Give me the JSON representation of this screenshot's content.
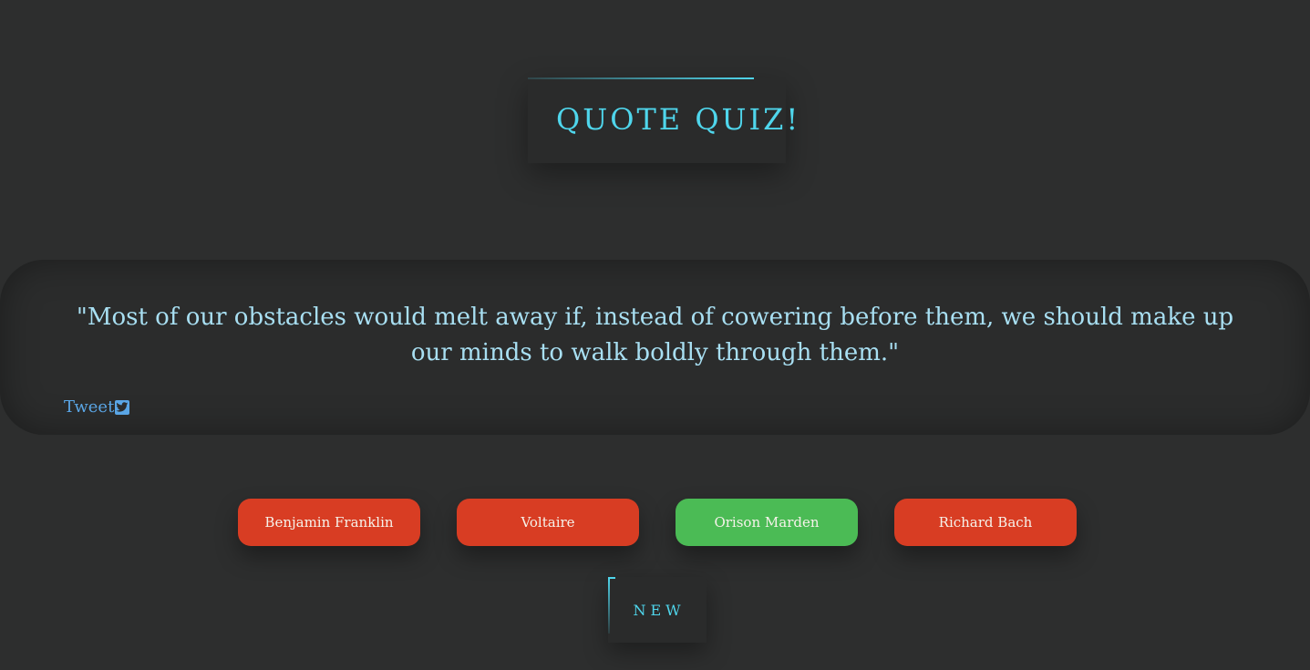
{
  "header": {
    "title": "QUOTE QUIZ!"
  },
  "quote": {
    "text": "\"Most of our obstacles would melt away if, instead of cowering before them, we should make up our minds to walk boldly through them.\"",
    "tweet_label": "Tweet",
    "tweet_icon": "twitter-icon"
  },
  "answers": [
    {
      "label": "Benjamin Franklin",
      "color": "#d83d23"
    },
    {
      "label": "Voltaire",
      "color": "#d83d23"
    },
    {
      "label": "Orison Marden",
      "color": "#4bbb55"
    },
    {
      "label": "Richard Bach",
      "color": "#d83d23"
    }
  ],
  "controls": {
    "new_label": "NEW"
  },
  "colors": {
    "background": "#2d2e2e",
    "accent": "#4fd6ec",
    "quote_text": "#a8dff2",
    "link": "#5aa6e6"
  }
}
